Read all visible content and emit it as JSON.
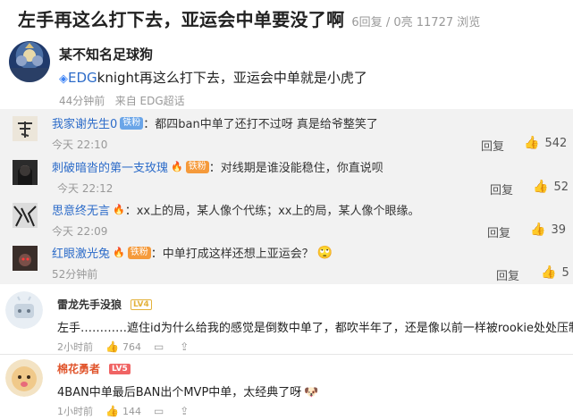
{
  "post": {
    "title": "左手再这么打下去，亚运会中单要没了啊",
    "replies_stat": "6回复",
    "likes_stat": "0亮",
    "views_stat": "11727 浏览"
  },
  "main_comment": {
    "username": "某不知名足球狗",
    "tag": "EDG",
    "text": "knight再这么打下去，亚运会中单就是小虎了",
    "time": "44分钟前",
    "source": "来自 EDG超话"
  },
  "replies": [
    {
      "username": "我家谢先生0",
      "badge": "铁粉",
      "text": "：都四ban中单了还打不过呀 真是给爷整笑了",
      "time": "今天 22:10",
      "reply_label": "回复",
      "likes": "542"
    },
    {
      "username": "刺破暗沓的第一支玫瑰",
      "badge": "铁粉",
      "text": "：对线期是谁没能稳住，你直说呗",
      "time": "今天 22:12",
      "reply_label": "回复",
      "likes": "52"
    },
    {
      "username": "思意终无言",
      "badge": "",
      "text": "：xx上的局，某人像个代练；xx上的局，某人像个眼缘。",
      "time": "今天 22:09",
      "reply_label": "回复",
      "likes": "39"
    },
    {
      "username": "红眼激光兔",
      "badge": "铁粉",
      "text": "：中单打成这样还想上亚运会？",
      "time": "52分钟前",
      "reply_label": "回复",
      "likes": "5"
    }
  ],
  "comments": [
    {
      "username": "雷龙先手没狼",
      "level": "LV4",
      "text": "左手…………遮住id为什么给我的感觉是倒数中单了，都吹半年了，还是像以前一样被rookie处处压制。",
      "time": "2小时前",
      "likes": "764"
    },
    {
      "username": "棉花勇者",
      "level": "LV5",
      "text": "4BAN中单最后BAN出个MVP中单，太经典了呀",
      "time": "1小时前",
      "likes": "144"
    }
  ],
  "icons": {
    "thumb": "thumbs-up-icon",
    "comment": "comment-icon",
    "share": "share-icon",
    "tag": "super-topic-icon"
  }
}
